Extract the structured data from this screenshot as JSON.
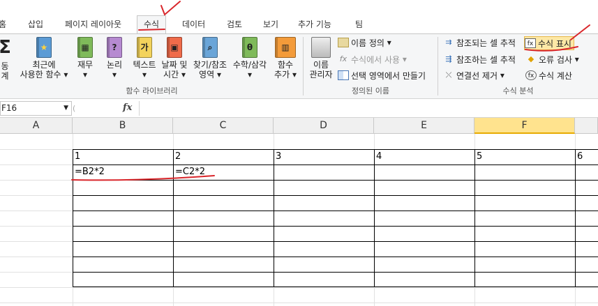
{
  "tabs": [
    "홈",
    "삽입",
    "페이지 레이아웃",
    "수식",
    "데이터",
    "검토",
    "보기",
    "추가 기능",
    "팀"
  ],
  "active_tab": "수식",
  "function_library": {
    "autosum": {
      "line1": "동",
      "line2": "계"
    },
    "recent": {
      "line1": "최근에",
      "line2": "사용한 함수"
    },
    "finance": {
      "line1": "재무"
    },
    "logic": {
      "line1": "논리"
    },
    "text": {
      "line1": "텍스트"
    },
    "datetime": {
      "line1": "날짜 및",
      "line2": "시간"
    },
    "lookup": {
      "line1": "찾기/참조",
      "line2": "영역"
    },
    "math": {
      "line1": "수학/삼각"
    },
    "more": {
      "line1": "함수",
      "line2": "추가"
    },
    "label": "함수 라이브러리"
  },
  "defined_names": {
    "manager": {
      "line1": "이름",
      "line2": "관리자"
    },
    "define_name": "이름 정의",
    "use_in_formula": "수식에서 사용",
    "create_from_selection": "선택 영역에서 만들기",
    "label": "정의된 이름"
  },
  "formula_auditing": {
    "trace_precedents": "참조되는 셀 추적",
    "trace_dependents": "참조하는 셀 추적",
    "remove_arrows": "연결선 제거",
    "show_formulas": "수식 표시",
    "error_checking": "오류 검사",
    "evaluate_formula": "수식 계산",
    "label": "수식 분석"
  },
  "formula_bar": {
    "name_box": "F16",
    "fx": "fx",
    "content": ""
  },
  "columns": [
    "A",
    "B",
    "C",
    "D",
    "E",
    "F"
  ],
  "selected_column": "F",
  "cells": {
    "row1": [
      "1",
      "2",
      "",
      "",
      "",
      "6"
    ],
    "row1_full": {
      "B": "1",
      "C": "2",
      "D": "3",
      "E": "4",
      "F": "5",
      "G": "6"
    },
    "row2": {
      "B": "=B2*2",
      "C": "=C2*2"
    }
  },
  "accent": "#d9262b"
}
